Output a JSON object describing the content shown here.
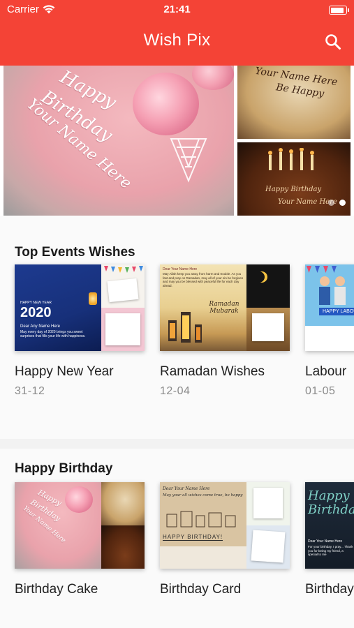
{
  "status_bar": {
    "carrier": "Carrier",
    "time": "21:41",
    "battery_level": 0.9
  },
  "header": {
    "title": "Wish Pix",
    "icon": "search-icon"
  },
  "banner": {
    "main_text": [
      "Happy",
      "Birthday",
      "Your Name Here"
    ],
    "side_top_text": [
      "Your Name Here",
      "Be Happy"
    ],
    "side_bottom_text": [
      "Happy Birthday",
      "Your Name Here"
    ],
    "page_count": 2,
    "active_page": 2
  },
  "sections": [
    {
      "title": "Top Events Wishes",
      "cards": [
        {
          "name": "Happy New Year",
          "date": "31-12",
          "art": {
            "year": "2020",
            "tag": "HAPPY NEW YEAR",
            "name_line": "Dear Any Name Here",
            "msg": "May every day of 2020 brings you sweet surprises that fills your life with happiness."
          }
        },
        {
          "name": "Ramadan Wishes",
          "date": "12-04",
          "art": {
            "head": "Dear Your Name Here",
            "msg": "May Allah keep you away from harm and trouble. As you fast and pray on Ramadan, may all of your sin be forgiven and may you be blessed with peaceful life for each day ahead.",
            "title": "Ramadan Mubarak"
          }
        },
        {
          "name": "Labour",
          "date": "01-05",
          "art": {
            "tag": "HAPPY LABOUR"
          }
        }
      ]
    },
    {
      "title": "Happy Birthday",
      "cards": [
        {
          "name": "Birthday Cake",
          "art": {
            "main_text": [
              "Happy",
              "Birthday",
              "Your Name Here"
            ]
          }
        },
        {
          "name": "Birthday Card",
          "art": {
            "head": "Dear Your Name Here",
            "msg": "May your all wishes come true, be happy",
            "title": "HAPPY BIRTHDAY!"
          }
        },
        {
          "name": "Birthday",
          "art": {
            "script": "Happy Birthday",
            "name_line": "Dear Your Name Here",
            "msg": "For your birthday, I pray... Thank you for being my friend, a special to me"
          }
        }
      ]
    }
  ],
  "colors": {
    "brand": "#f44336",
    "background": "#f2f2f2",
    "section": "#fafafa",
    "date": "#8a8a8a"
  }
}
